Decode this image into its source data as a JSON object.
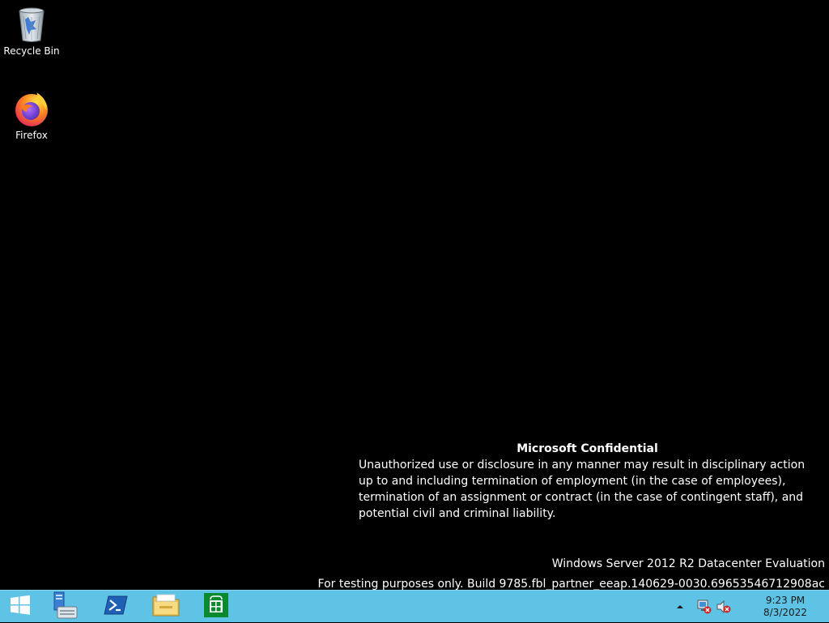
{
  "desktop": {
    "icons": [
      {
        "label": "Recycle Bin",
        "icon": "recycle-bin-icon"
      },
      {
        "label": "Firefox",
        "icon": "firefox-icon"
      }
    ],
    "notice": {
      "title": "Microsoft Confidential",
      "body": "Unauthorized use or disclosure in any manner may result in disciplinary action up to and including termination of employment (in the case of employees), termination of an assignment or contract (in the case of contingent staff), and potential civil and criminal liability."
    },
    "watermark": {
      "edition": "Windows Server 2012 R2 Datacenter Evaluation",
      "build": "For testing purposes only. Build 9785.fbl_partner_eeap.140629-0030.69653546712908ac"
    }
  },
  "taskbar": {
    "color": "#5fc3e6",
    "pinned": [
      {
        "name": "windows-logo-icon"
      },
      {
        "name": "server-manager-icon"
      },
      {
        "name": "powershell-icon"
      },
      {
        "name": "file-explorer-icon"
      },
      {
        "name": "store-icon"
      }
    ],
    "tray": {
      "icons": [
        "show-hidden-icons-chevron",
        "network-error-icon",
        "volume-muted-icon"
      ],
      "time": "9:23 PM",
      "date": "8/3/2022"
    }
  }
}
